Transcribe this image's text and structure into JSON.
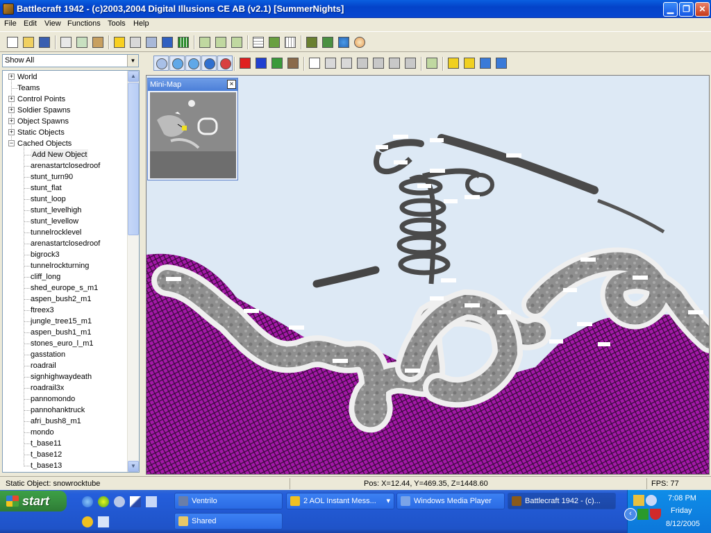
{
  "window": {
    "title": "Battlecraft 1942 - (c)2003,2004 Digital Illusions CE AB (v2.1) [SummerNights]"
  },
  "menu": [
    "File",
    "Edit",
    "View",
    "Functions",
    "Tools",
    "Help"
  ],
  "filter": {
    "selected": "Show All"
  },
  "tree": {
    "roots": [
      "World",
      "Teams",
      "Control Points",
      "Soldier Spawns",
      "Object Spawns",
      "Static Objects",
      "Cached Objects"
    ],
    "cached_children": [
      "Add New Object",
      "arenastartclosedroof",
      "stunt_turn90",
      "stunt_flat",
      "stunt_loop",
      "stunt_levelhigh",
      "stunt_levellow",
      "tunnelrocklevel",
      "arenastartclosedroof",
      "bigrock3",
      "tunnelrockturning",
      "cliff_long",
      "shed_europe_s_m1",
      "aspen_bush2_m1",
      "ftreex3",
      "jungle_tree15_m1",
      "aspen_bush1_m1",
      "stones_euro_l_m1",
      "gasstation",
      "roadrail",
      "signhighwaydeath",
      "roadrail3x",
      "pannomondo",
      "pannohanktruck",
      "afri_bush8_m1",
      "mondo",
      "t_base11",
      "t_base12",
      "t_base13"
    ]
  },
  "minimap": {
    "title": "Mini-Map",
    "close": "×"
  },
  "status": {
    "object": "Static Object: snowrocktube",
    "pos": "Pos: X=12.44, Y=469.35, Z=1448.60",
    "fps": "FPS: 77"
  },
  "taskbar": {
    "start": "start",
    "tasks": [
      {
        "label": "Ventrilo",
        "color": "#6a7ea8"
      },
      {
        "label": "2 AOL Instant Mess...",
        "color": "#f0c020"
      },
      {
        "label": "Windows Media Player",
        "color": "#7aa4e8"
      },
      {
        "label": "Battlecraft 1942 - (c)...",
        "color": "#8a5a1a"
      },
      {
        "label": "Shared",
        "color": "#e8c868"
      }
    ],
    "clock": {
      "time": "7:08 PM",
      "day": "Friday",
      "date": "8/12/2005"
    }
  },
  "colors": {
    "xp_blue": "#0a5fe0",
    "terrain_magenta": "#a418a8",
    "sky": "#dde9f5",
    "rock_gray": "#8f8f8f"
  },
  "icons": {
    "toolbar1": [
      "new-file-icon",
      "open-folder-icon",
      "save-icon",
      "cut-icon",
      "copy-icon",
      "paste-icon",
      "burst-icon",
      "window-icon",
      "stack-icon",
      "person-icon",
      "grid-icon",
      "export-icon",
      "import-icon",
      "import2-icon",
      "grid-view-icon",
      "texture-icon",
      "grid-view2-icon",
      "people-icon",
      "map-icon",
      "globe-icon",
      "palette-icon"
    ],
    "toolbar2": [
      "home-icon",
      "globe-icon",
      "camera-icon",
      "dot-icon",
      "flag-icon",
      "red-cube-icon",
      "blue-cube-icon",
      "tree-icon",
      "rock-icon",
      "cursor-icon",
      "move-icon",
      "move-vertical-icon",
      "rotate-x-icon",
      "rotate-y-icon",
      "rotate-z-icon",
      "scale-icon",
      "export-icon",
      "lock-icon",
      "lock2-icon",
      "target-icon",
      "settings-icon"
    ]
  }
}
